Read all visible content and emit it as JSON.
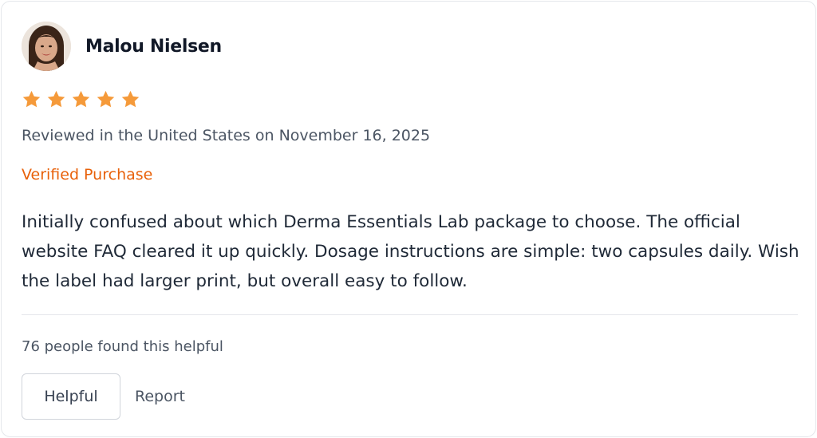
{
  "review": {
    "reviewer_name": "Malou Nielsen",
    "avatar_icon": "user-photo-avatar",
    "rating": 5,
    "rating_max": 5,
    "star_color": "#f59a3a",
    "meta_text": "Reviewed in the United States on November 16, 2025",
    "verified_label": "Verified Purchase",
    "verified_color": "#e8610a",
    "body": "Initially confused about which Derma Essentials Lab package to choose. The official website FAQ cleared it up quickly. Dosage instructions are simple: two capsules daily. Wish the label had larger print, but overall easy to follow.",
    "helpful_count_text": "76 people found this helpful",
    "helpful_button_label": "Helpful",
    "report_label": "Report"
  }
}
